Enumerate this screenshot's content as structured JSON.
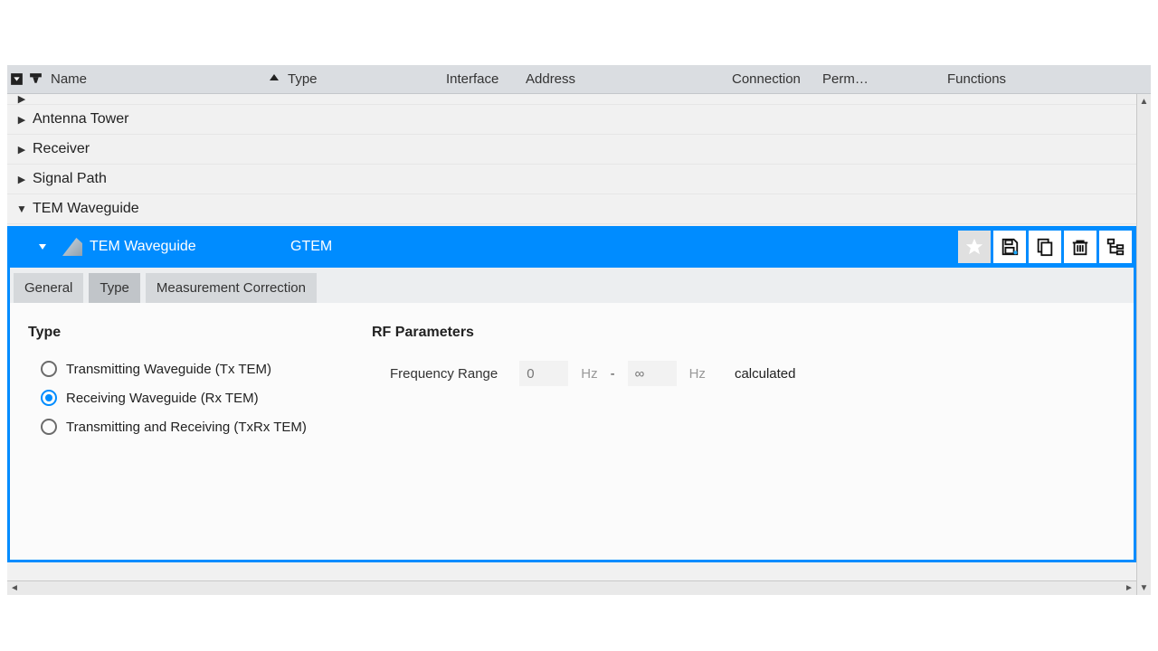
{
  "header": {
    "name": "Name",
    "type": "Type",
    "interface": "Interface",
    "address": "Address",
    "connection": "Connection",
    "perm": "Perm…",
    "functions": "Functions"
  },
  "tree": {
    "cutoff_label": "",
    "items": [
      {
        "label": "Antenna Tower",
        "expanded": false
      },
      {
        "label": "Receiver",
        "expanded": false
      },
      {
        "label": "Signal Path",
        "expanded": false
      },
      {
        "label": "TEM Waveguide",
        "expanded": true
      }
    ]
  },
  "selected": {
    "name": "TEM Waveguide",
    "type": "GTEM"
  },
  "tabs": {
    "general": "General",
    "type": "Type",
    "measurement_correction": "Measurement Correction",
    "active": "type"
  },
  "type_section": {
    "heading": "Type",
    "options": [
      {
        "id": "tx",
        "label": "Transmitting Waveguide (Tx TEM)"
      },
      {
        "id": "rx",
        "label": "Receiving Waveguide (Rx TEM)"
      },
      {
        "id": "txrx",
        "label": "Transmitting and Receiving (TxRx TEM)"
      }
    ],
    "selected": "rx"
  },
  "rf_section": {
    "heading": "RF Parameters",
    "freq_label": "Frequency Range",
    "from_placeholder": "0",
    "from_unit": "Hz",
    "dash": "-",
    "to_placeholder": "∞",
    "to_unit": "Hz",
    "calculated": "calculated"
  }
}
